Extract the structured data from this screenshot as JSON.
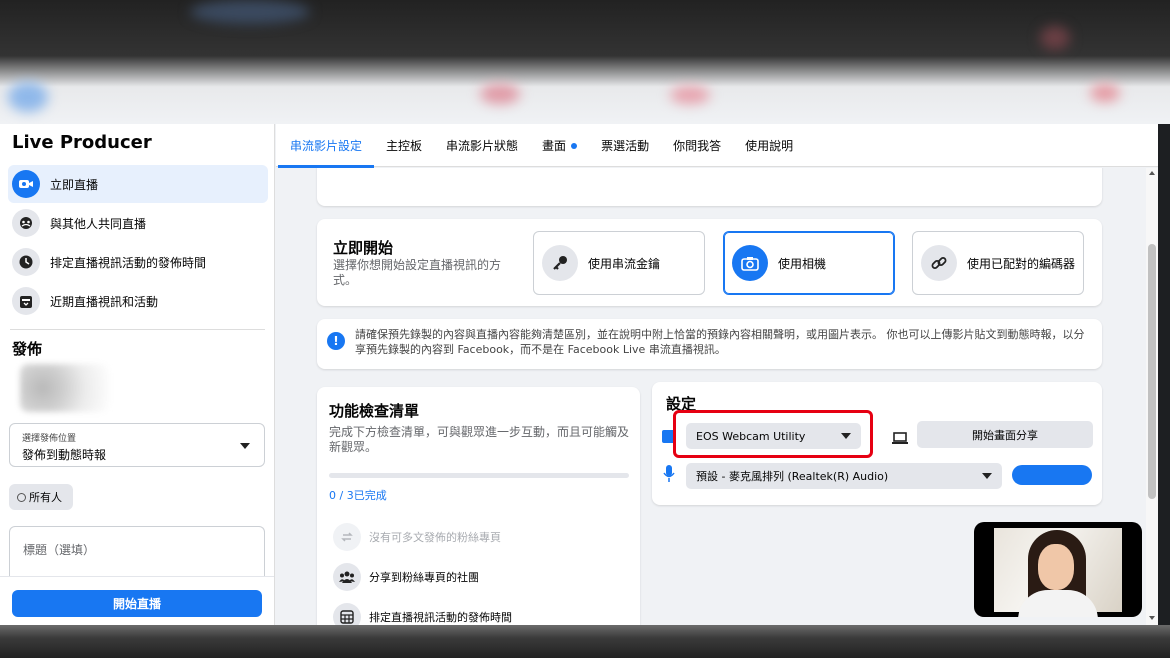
{
  "sidebar": {
    "title": "Live Producer",
    "items": [
      {
        "label": "立即直播",
        "icon": "camera-icon"
      },
      {
        "label": "與其他人共同直播",
        "icon": "people-icon"
      },
      {
        "label": "排定直播視訊活動的發佈時間",
        "icon": "clock-icon"
      },
      {
        "label": "近期直播視訊和活動",
        "icon": "calendar-icon"
      }
    ],
    "section_title": "發佈",
    "post_location_label": "選擇發佈位置",
    "post_location_value": "發佈到動態時報",
    "audience_label": "所有人",
    "title_placeholder": "標題（選填）",
    "go_live_label": "開始直播"
  },
  "tabs": [
    "串流影片設定",
    "主控板",
    "串流影片狀態",
    "畫面",
    "票選活動",
    "你問我答",
    "使用說明"
  ],
  "start_now": {
    "title": "立即開始",
    "subtitle": "選擇你想開始設定直播視訊的方式。",
    "options": [
      {
        "label": "使用串流金鑰",
        "icon": "key-icon"
      },
      {
        "label": "使用相機",
        "icon": "camera-icon"
      },
      {
        "label": "使用已配對的編碼器",
        "icon": "link-icon"
      }
    ]
  },
  "notice": {
    "text": "請確保預先錄製的內容與直播內容能夠清楚區別，並在說明中附上恰當的預錄內容相關聲明，或用圖片表示。 你也可以上傳影片貼文到動態時報，以分享預先錄製的內容到 Facebook，而不是在 Facebook Live 串流直播視訊。"
  },
  "checklist": {
    "title": "功能檢查清單",
    "subtitle": "完成下方檢查清單，可與觀眾進一步互動，而且可能觸及新觀眾。",
    "progress_text": "0 / 3已完成",
    "progress_fraction": 0,
    "items": [
      {
        "label": "沒有可多文發佈的粉絲專頁",
        "icon": "repost-icon",
        "disabled": true
      },
      {
        "label": "分享到粉絲專頁的社團",
        "icon": "group-icon",
        "disabled": false
      },
      {
        "label": "排定直播視訊活動的發佈時間",
        "icon": "calendar-grid-icon",
        "disabled": false
      }
    ]
  },
  "settings": {
    "title": "設定",
    "camera_value": "EOS Webcam Utility",
    "share_screen_label": "開始畫面分享",
    "mic_value": "預設 - 麥克風排列 (Realtek(R) Audio)"
  },
  "colors": {
    "accent": "#1877f2",
    "highlight": "#e60012"
  }
}
